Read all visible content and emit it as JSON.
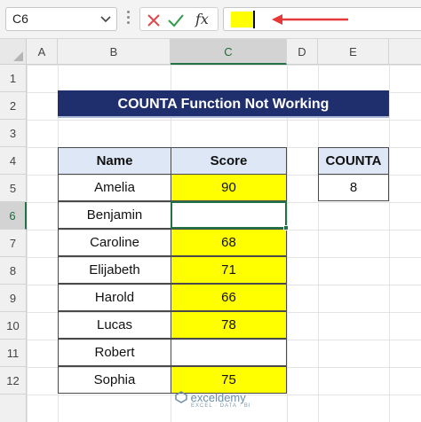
{
  "formula_bar": {
    "name_box": "C6",
    "cancel_icon": "close-icon",
    "enter_icon": "check-icon",
    "fx_label": "fx",
    "fill_preview_color": "#ffff00",
    "arrow_color": "#e63838"
  },
  "columns": [
    "A",
    "B",
    "C",
    "D",
    "E"
  ],
  "rows": [
    "1",
    "2",
    "3",
    "4",
    "5",
    "6",
    "7",
    "8",
    "9",
    "10",
    "11",
    "12"
  ],
  "selected_cell": "C6",
  "title": "COUNTA Function Not Working",
  "table": {
    "headers": [
      "Name",
      "Score"
    ],
    "rows": [
      {
        "name": "Amelia",
        "score": "90",
        "highlight": true
      },
      {
        "name": "Benjamin",
        "score": "",
        "highlight": false
      },
      {
        "name": "Caroline",
        "score": "68",
        "highlight": true
      },
      {
        "name": "Elijabeth",
        "score": "71",
        "highlight": true
      },
      {
        "name": "Harold",
        "score": "66",
        "highlight": true
      },
      {
        "name": "Lucas",
        "score": "78",
        "highlight": true
      },
      {
        "name": "Robert",
        "score": "",
        "highlight": false
      },
      {
        "name": "Sophia",
        "score": "75",
        "highlight": true
      }
    ]
  },
  "counta": {
    "header": "COUNTA",
    "value": "8"
  },
  "watermark": {
    "name": "exceldemy",
    "tagline": "EXCEL · DATA · BI"
  },
  "colors": {
    "title_bg": "#1f2f6e",
    "header_bg": "#dde7f5",
    "highlight": "#ffff00",
    "excel_green": "#217346"
  }
}
